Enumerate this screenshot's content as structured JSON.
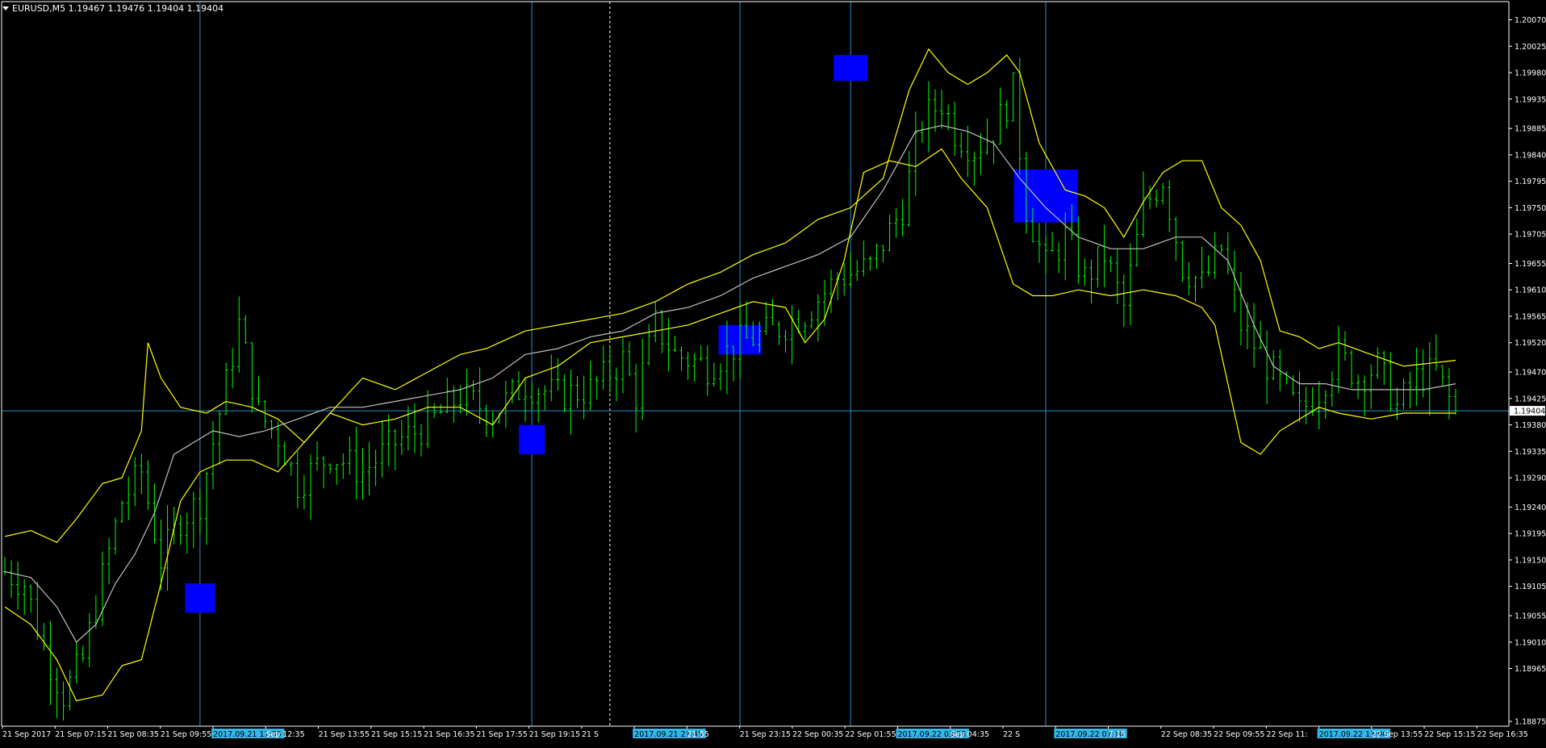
{
  "header": {
    "symbol_line": "EURUSD,M5  1.19467 1.19476 1.19404 1.19404"
  },
  "colors": {
    "background": "#000000",
    "axis": "#ffffff",
    "candle": "#00ff00",
    "bands": "#ffff00",
    "middle_band": "#c0c0c0",
    "vline": "#1e90c8",
    "marker": "#0000ff",
    "date_highlight": "#2fb8e8"
  },
  "chart_data": {
    "type": "candlestick",
    "y_ticks": [
      "1.20070",
      "1.20025",
      "1.19980",
      "1.19935",
      "1.19885",
      "1.19840",
      "1.19795",
      "1.19750",
      "1.19705",
      "1.19655",
      "1.19610",
      "1.19565",
      "1.19520",
      "1.19470",
      "1.19425",
      "1.19380",
      "1.19335",
      "1.19290",
      "1.19240",
      "1.19195",
      "1.19150",
      "1.19105",
      "1.19055",
      "1.19010",
      "1.18965",
      "1.18875"
    ],
    "ylim": [
      1.18875,
      1.2009
    ],
    "current_price": "1.19404",
    "x_ticks": [
      "21 Sep 2017",
      "21 Sep 07:15",
      "21 Sep 08:35",
      "21 Sep 09:55",
      "2017.09.21 11:55",
      "Sep 12:35",
      "21 Sep 13:55",
      "21 Sep 15:15",
      "21 Sep 16:35",
      "21 Sep 17:55",
      "21 Sep 19:15",
      "21 S",
      "2017.09.21 21:45",
      "21:55",
      "21 Sep 23:15",
      "22 Sep 00:35",
      "22 Sep 01:55",
      "2017.09.22 03:55",
      "Sep 04:35",
      "22 S",
      "2017.09.22 07:10",
      "7:15",
      "22 Sep 08:35",
      "22 Sep 09:55",
      "22 Sep 11:",
      "2017.09.22 13:00",
      "22 Sep 13:55",
      "22 Sep 15:15",
      "22 Sep 16:35"
    ],
    "highlighted_dates": [
      "2017.09.21 11:55",
      "2017.09.21 21:45",
      "2017.09.22 03:55",
      "2017.09.22 07:10",
      "2017.09.22 13:00"
    ],
    "price_path": [
      [
        0,
        1.1913
      ],
      [
        3,
        1.1911
      ],
      [
        6,
        1.19
      ],
      [
        9,
        1.1892
      ],
      [
        12,
        1.1898
      ],
      [
        15,
        1.1912
      ],
      [
        18,
        1.1925
      ],
      [
        21,
        1.193
      ],
      [
        24,
        1.1915
      ],
      [
        27,
        1.1922
      ],
      [
        30,
        1.1925
      ],
      [
        33,
        1.194
      ],
      [
        36,
        1.1955
      ],
      [
        39,
        1.194
      ],
      [
        42,
        1.1936
      ],
      [
        45,
        1.1928
      ],
      [
        50,
        1.1933
      ],
      [
        55,
        1.193
      ],
      [
        60,
        1.1935
      ],
      [
        65,
        1.1938
      ],
      [
        70,
        1.1943
      ],
      [
        75,
        1.194
      ],
      [
        80,
        1.1945
      ],
      [
        85,
        1.1943
      ],
      [
        90,
        1.1944
      ],
      [
        95,
        1.1949
      ],
      [
        97,
        1.1943
      ],
      [
        100,
        1.1955
      ],
      [
        103,
        1.195
      ],
      [
        108,
        1.1948
      ],
      [
        113,
        1.1952
      ],
      [
        118,
        1.1954
      ],
      [
        123,
        1.1957
      ],
      [
        128,
        1.1963
      ],
      [
        133,
        1.1965
      ],
      [
        138,
        1.1975
      ],
      [
        141,
        1.199
      ],
      [
        144,
        1.1993
      ],
      [
        146,
        1.1988
      ],
      [
        149,
        1.1985
      ],
      [
        152,
        1.1988
      ],
      [
        155,
        1.1995
      ],
      [
        157,
        1.1975
      ],
      [
        160,
        1.1965
      ],
      [
        163,
        1.197
      ],
      [
        166,
        1.1963
      ],
      [
        169,
        1.1967
      ],
      [
        172,
        1.1958
      ],
      [
        175,
        1.1975
      ],
      [
        178,
        1.198
      ],
      [
        181,
        1.1965
      ],
      [
        184,
        1.1962
      ],
      [
        187,
        1.1968
      ],
      [
        190,
        1.1955
      ],
      [
        193,
        1.195
      ],
      [
        196,
        1.1945
      ],
      [
        199,
        1.194
      ],
      [
        202,
        1.1944
      ],
      [
        205,
        1.195
      ],
      [
        208,
        1.1946
      ],
      [
        211,
        1.1948
      ],
      [
        214,
        1.1941
      ],
      [
        217,
        1.1946
      ],
      [
        220,
        1.1947
      ],
      [
        223,
        1.194
      ]
    ],
    "upper_band": [
      [
        0,
        1.1919
      ],
      [
        4,
        1.192
      ],
      [
        8,
        1.1918
      ],
      [
        11,
        1.1922
      ],
      [
        15,
        1.1928
      ],
      [
        18,
        1.1929
      ],
      [
        21,
        1.1937
      ],
      [
        22,
        1.1952
      ],
      [
        24,
        1.1946
      ],
      [
        27,
        1.1941
      ],
      [
        31,
        1.194
      ],
      [
        34,
        1.1942
      ],
      [
        38,
        1.1941
      ],
      [
        42,
        1.1939
      ],
      [
        46,
        1.1935
      ],
      [
        50,
        1.194
      ],
      [
        55,
        1.1946
      ],
      [
        60,
        1.1944
      ],
      [
        65,
        1.1947
      ],
      [
        70,
        1.195
      ],
      [
        74,
        1.1951
      ],
      [
        80,
        1.1954
      ],
      [
        85,
        1.1955
      ],
      [
        90,
        1.1956
      ],
      [
        95,
        1.1957
      ],
      [
        100,
        1.1959
      ],
      [
        105,
        1.1962
      ],
      [
        110,
        1.1964
      ],
      [
        115,
        1.1967
      ],
      [
        120,
        1.1969
      ],
      [
        125,
        1.1973
      ],
      [
        130,
        1.1975
      ],
      [
        135,
        1.198
      ],
      [
        139,
        1.1995
      ],
      [
        142,
        1.2002
      ],
      [
        145,
        1.1998
      ],
      [
        148,
        1.1996
      ],
      [
        151,
        1.1998
      ],
      [
        154,
        1.2001
      ],
      [
        156,
        1.1998
      ],
      [
        159,
        1.1986
      ],
      [
        163,
        1.1978
      ],
      [
        166,
        1.1977
      ],
      [
        169,
        1.1975
      ],
      [
        172,
        1.197
      ],
      [
        175,
        1.1976
      ],
      [
        178,
        1.1981
      ],
      [
        181,
        1.1983
      ],
      [
        184,
        1.1983
      ],
      [
        187,
        1.1975
      ],
      [
        190,
        1.1972
      ],
      [
        193,
        1.1966
      ],
      [
        196,
        1.1954
      ],
      [
        199,
        1.1953
      ],
      [
        202,
        1.1951
      ],
      [
        205,
        1.1952
      ],
      [
        210,
        1.195
      ],
      [
        215,
        1.1948
      ],
      [
        223,
        1.1949
      ]
    ],
    "lower_band": [
      [
        0,
        1.1907
      ],
      [
        4,
        1.1904
      ],
      [
        8,
        1.1898
      ],
      [
        11,
        1.1891
      ],
      [
        15,
        1.1892
      ],
      [
        18,
        1.1897
      ],
      [
        21,
        1.1898
      ],
      [
        24,
        1.1911
      ],
      [
        27,
        1.1925
      ],
      [
        30,
        1.193
      ],
      [
        34,
        1.1932
      ],
      [
        38,
        1.1932
      ],
      [
        42,
        1.193
      ],
      [
        46,
        1.1935
      ],
      [
        50,
        1.194
      ],
      [
        55,
        1.1938
      ],
      [
        60,
        1.1939
      ],
      [
        65,
        1.1941
      ],
      [
        70,
        1.1941
      ],
      [
        75,
        1.1938
      ],
      [
        80,
        1.1946
      ],
      [
        85,
        1.1948
      ],
      [
        90,
        1.1952
      ],
      [
        95,
        1.1953
      ],
      [
        100,
        1.1954
      ],
      [
        105,
        1.1955
      ],
      [
        110,
        1.1957
      ],
      [
        115,
        1.1959
      ],
      [
        120,
        1.1958
      ],
      [
        123,
        1.1952
      ],
      [
        126,
        1.1956
      ],
      [
        129,
        1.1966
      ],
      [
        132,
        1.1981
      ],
      [
        136,
        1.1983
      ],
      [
        140,
        1.1982
      ],
      [
        144,
        1.1985
      ],
      [
        147,
        1.198
      ],
      [
        151,
        1.1975
      ],
      [
        155,
        1.1962
      ],
      [
        158,
        1.196
      ],
      [
        161,
        1.196
      ],
      [
        165,
        1.1961
      ],
      [
        170,
        1.196
      ],
      [
        175,
        1.1961
      ],
      [
        180,
        1.196
      ],
      [
        184,
        1.1958
      ],
      [
        186,
        1.1955
      ],
      [
        190,
        1.1935
      ],
      [
        193,
        1.1933
      ],
      [
        196,
        1.1937
      ],
      [
        199,
        1.1939
      ],
      [
        202,
        1.1941
      ],
      [
        205,
        1.194
      ],
      [
        210,
        1.1939
      ],
      [
        215,
        1.194
      ],
      [
        223,
        1.194
      ]
    ],
    "middle_band": [
      [
        0,
        1.1913
      ],
      [
        4,
        1.1912
      ],
      [
        8,
        1.1907
      ],
      [
        11,
        1.1901
      ],
      [
        14,
        1.1904
      ],
      [
        17,
        1.1911
      ],
      [
        20,
        1.1916
      ],
      [
        23,
        1.1923
      ],
      [
        26,
        1.1933
      ],
      [
        29,
        1.1935
      ],
      [
        32,
        1.1937
      ],
      [
        36,
        1.1936
      ],
      [
        40,
        1.1937
      ],
      [
        45,
        1.1939
      ],
      [
        50,
        1.1941
      ],
      [
        55,
        1.1941
      ],
      [
        60,
        1.1942
      ],
      [
        65,
        1.1943
      ],
      [
        70,
        1.1944
      ],
      [
        75,
        1.1946
      ],
      [
        80,
        1.195
      ],
      [
        85,
        1.1951
      ],
      [
        90,
        1.1953
      ],
      [
        95,
        1.1954
      ],
      [
        100,
        1.1957
      ],
      [
        105,
        1.1958
      ],
      [
        110,
        1.196
      ],
      [
        115,
        1.1963
      ],
      [
        120,
        1.1965
      ],
      [
        125,
        1.1967
      ],
      [
        130,
        1.197
      ],
      [
        135,
        1.1978
      ],
      [
        140,
        1.1988
      ],
      [
        144,
        1.1989
      ],
      [
        148,
        1.1988
      ],
      [
        152,
        1.1986
      ],
      [
        156,
        1.198
      ],
      [
        160,
        1.1975
      ],
      [
        165,
        1.197
      ],
      [
        170,
        1.1968
      ],
      [
        175,
        1.1968
      ],
      [
        180,
        1.197
      ],
      [
        184,
        1.197
      ],
      [
        188,
        1.1966
      ],
      [
        192,
        1.1955
      ],
      [
        195,
        1.1948
      ],
      [
        199,
        1.1945
      ],
      [
        203,
        1.1945
      ],
      [
        207,
        1.1944
      ],
      [
        212,
        1.1944
      ],
      [
        218,
        1.1944
      ],
      [
        223,
        1.1945
      ]
    ],
    "markers": [
      {
        "center_bar": 30,
        "center_price": 1.19085,
        "half_width_bars": 2.3,
        "half_height": 0.00025
      },
      {
        "center_bar": 81,
        "center_price": 1.19355,
        "half_width_bars": 2.0,
        "half_height": 0.00025
      },
      {
        "center_bar": 113,
        "center_price": 1.19525,
        "half_width_bars": 3.3,
        "half_height": 0.00025
      },
      {
        "center_bar": 130,
        "center_price": 1.19988,
        "half_width_bars": 2.6,
        "half_height": 0.00022
      },
      {
        "center_bar": 160,
        "center_price": 1.1977,
        "half_width_bars": 4.9,
        "half_height": 0.00045
      }
    ],
    "bar_count": 224
  }
}
